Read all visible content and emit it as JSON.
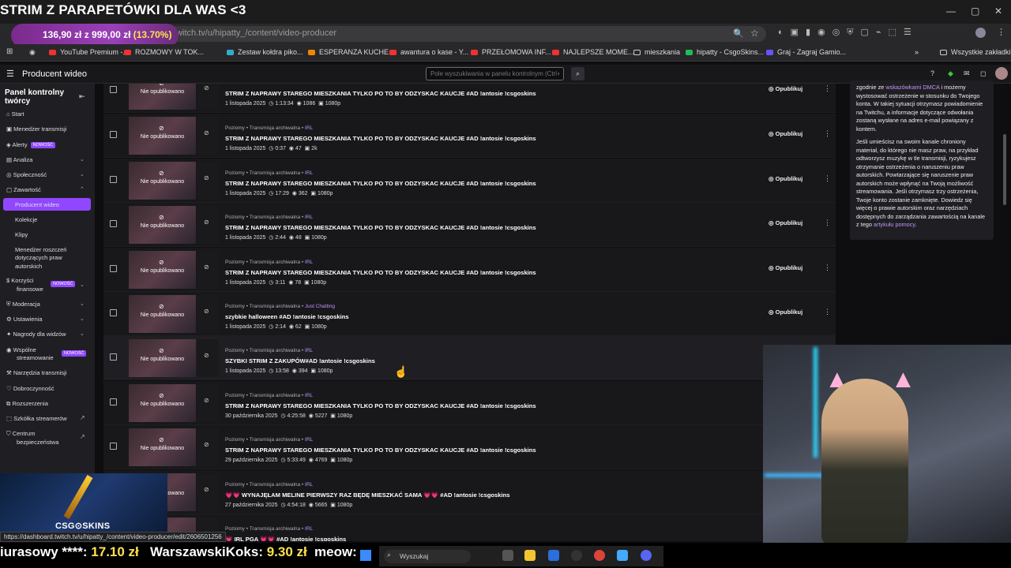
{
  "overlay": {
    "stream_title": "STRIM Z PARAPETÓWKI DLA WAS <3",
    "donation_goal": "136,90 zł z 999,00 zł",
    "donation_pct": "(13.70%)",
    "donation_progress": 0.137,
    "ticker": [
      {
        "name": "iurasowy ****:",
        "amount": "17.10 zł"
      },
      {
        "name": "WarszawskiKoks:",
        "amount": "9.30 zł"
      },
      {
        "name": "meow:",
        "amount": ""
      }
    ],
    "csgo_logo": "CSG⊙SKINS"
  },
  "browser": {
    "url": "dashboard.twitch.tv/u/hipatty_/content/video-producer",
    "status_url": "https://dashboard.twitch.tv/u/hipatty_/content/video-producer/edit/2606501256",
    "bookmarks": [
      "YouTube Premium -...",
      "ROZMOWY W TOK...",
      "Zestaw kołdra piko...",
      "ESPERANZA KUCHE...",
      "awantura o kase - Y...",
      "PRZEŁOMOWA INF...",
      "NAJLEPSZE MOME...",
      "mieszkania",
      "hipatty - CsgoSkins...",
      "Graj - Zagraj Gamio..."
    ],
    "all_bookmarks": "Wszystkie zakładki"
  },
  "header": {
    "app_title": "Producent wideo",
    "search_placeholder": "Pole wyszukiwania w panelu kontrolnym (Ctrl+/)"
  },
  "sidebar": {
    "title": "Panel kontrolny twórcy",
    "items": {
      "start": "Start",
      "stream_manager": "Menedżer transmisji",
      "alerts": "Alerty",
      "analytics": "Analiza",
      "community": "Społeczność",
      "content": "Zawartość",
      "video_producer": "Producent wideo",
      "collections": "Kolekcje",
      "clips": "Klipy",
      "claims_1": "Menedżer roszczeń",
      "claims_2": "dotyczących praw",
      "claims_3": "autorskich",
      "monetization_1": "Korzyści",
      "monetization_2": "finansowe",
      "moderation": "Moderacja",
      "settings": "Ustawienia",
      "viewer_rewards": "Nagrody dla widzów",
      "collab_1": "Wspólne",
      "collab_2": "streamowanie",
      "tools": "Narzędzia transmisji",
      "charity": "Dobroczynność",
      "extensions": "Rozszerzenia",
      "school": "Szkółka streamerów",
      "safety_1": "Centrum",
      "safety_2": "bezpieczeństwa"
    },
    "new_badge": "NOWOŚĆ"
  },
  "videos": {
    "not_published": "Nie opublikowano",
    "publish": "Opublikuj",
    "rows": [
      {
        "meta": "",
        "cat": "",
        "title": "STRIM Z NAPRAWY STAREGO MIESZKANIA TYLKO PO TO BY ODZYSKAC KAUCJE #AD !antosie !csgoskins",
        "date": "1 listopada 2025",
        "dur": "1:13:34",
        "views": "1086",
        "q": "1080p"
      },
      {
        "meta": "Poziomy • Transmisja archiwalna • ",
        "cat": "IRL",
        "title": "STRIM Z NAPRAWY STAREGO MIESZKANIA TYLKO PO TO BY ODZYSKAC KAUCJE #AD !antosie !csgoskins",
        "date": "1 listopada 2025",
        "dur": "0:37",
        "views": "47",
        "q": "2k"
      },
      {
        "meta": "Poziomy • Transmisja archiwalna • ",
        "cat": "IRL",
        "title": "STRIM Z NAPRAWY STAREGO MIESZKANIA TYLKO PO TO BY ODZYSKAC KAUCJE #AD !antosie !csgoskins",
        "date": "1 listopada 2025",
        "dur": "17:29",
        "views": "362",
        "q": "1080p"
      },
      {
        "meta": "Poziomy • Transmisja archiwalna • ",
        "cat": "IRL",
        "title": "STRIM Z NAPRAWY STAREGO MIESZKANIA TYLKO PO TO BY ODZYSKAC KAUCJE #AD !antosie !csgoskins",
        "date": "1 listopada 2025",
        "dur": "2:44",
        "views": "48",
        "q": "1080p"
      },
      {
        "meta": "Poziomy • Transmisja archiwalna • ",
        "cat": "IRL",
        "title": "STRIM Z NAPRAWY STAREGO MIESZKANIA TYLKO PO TO BY ODZYSKAC KAUCJE #AD !antosie !csgoskins",
        "date": "1 listopada 2025",
        "dur": "3:11",
        "views": "78",
        "q": "1080p"
      },
      {
        "meta": "Poziomy • Transmisja archiwalna • ",
        "cat": "Just Chatting",
        "title": "szybkie halloween #AD !antosie !csgoskins",
        "date": "1 listopada 2025",
        "dur": "2:14",
        "views": "62",
        "q": "1080p"
      },
      {
        "meta": "Poziomy • Transmisja archiwalna • ",
        "cat": "IRL",
        "title": "SZYBKI STRIM Z ZAKUPÓW#AD !antosie !csgoskins",
        "date": "1 listopada 2025",
        "dur": "13:58",
        "views": "394",
        "q": "1080p"
      },
      {
        "meta": "Poziomy • Transmisja archiwalna • ",
        "cat": "IRL",
        "title": "STRIM Z NAPRAWY STAREGO MIESZKANIA TYLKO PO TO BY ODZYSKAC KAUCJE #AD !antosie !csgoskins",
        "date": "30 października 2025",
        "dur": "4:25:58",
        "views": "5227",
        "q": "1080p"
      },
      {
        "meta": "Poziomy • Transmisja archiwalna • ",
        "cat": "IRL",
        "title": "STRIM Z NAPRAWY STAREGO MIESZKANIA TYLKO PO TO BY ODZYSKAC KAUCJE #AD !antosie !csgoskins",
        "date": "29 października 2025",
        "dur": "5:33:49",
        "views": "4769",
        "q": "1080p"
      },
      {
        "meta": "Poziomy • Transmisja archiwalna • ",
        "cat": "IRL",
        "title": "💗💗 WYNAJĘŁAM MELINE PIERWSZY RAZ BĘDĘ MIESZKAĆ SAMA 💗💗 #AD !antosie !csgoskins",
        "date": "27 października 2025",
        "dur": "4:54:18",
        "views": "5665",
        "q": "1080p"
      },
      {
        "meta": "Poziomy • Transmisja archiwalna • ",
        "cat": "IRL",
        "title": "💗 IRL PGA 💗💗 #AD !antosie !csgoskins",
        "date": "",
        "dur": "",
        "views": "",
        "q": ""
      }
    ]
  },
  "info_panel": {
    "p1_a": "zgodnie ze ",
    "p1_link": "wskazówkami DMCA",
    "p1_b": " i możemy wystosować ostrzeżenie w stosunku do Twojego konta. W takiej sytuacji otrzymasz powiadomienie na Twitchu, a informacje dotyczące odwołania zostaną wysłane na adres e-mail powiązany z kontem.",
    "p2_a": "Jeśli umieścisz na swoim kanale chroniony materiał, do którego nie masz praw, na przykład odtworzysz muzykę w tle transmisji, ryzykujesz otrzymanie ostrzeżenia o naruszeniu praw autorskich. Powtarzające się naruszenie praw autorskich może wpłynąć na Twoją możliwość streamowania. Jeśli otrzymasz trzy ostrzeżenia, Twoje konto zostanie zamknięte. Dowiedz się więcej o prawie autorskim oraz narzędziach dostępnych do zarządzania zawartością na kanale z tego ",
    "p2_link": "artykułu pomocy",
    "p2_b": "."
  },
  "taskbar": {
    "search": "Wyszukaj"
  }
}
